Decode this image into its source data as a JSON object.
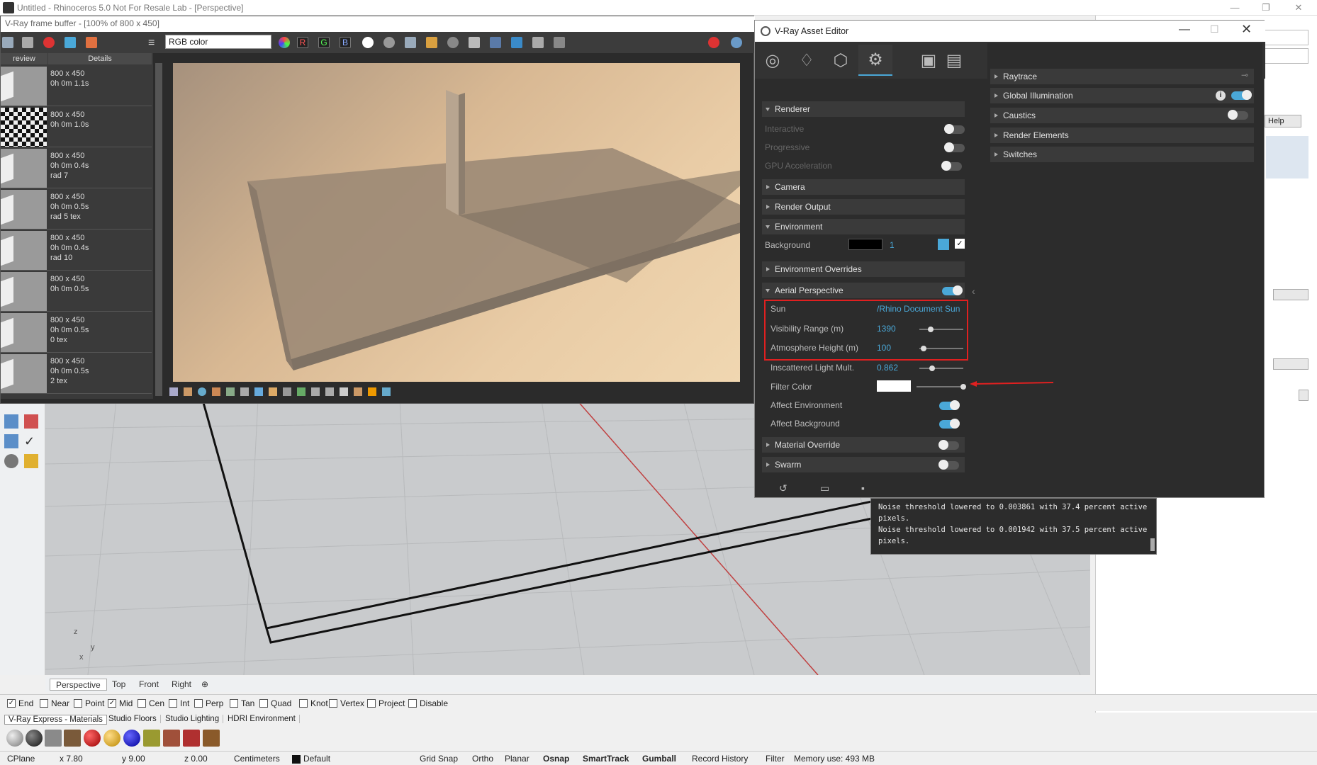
{
  "main_window": {
    "title": "Untitled - Rhinoceros 5.0 Not For Resale Lab - [Perspective]",
    "controls": [
      "—",
      "❐",
      "✕"
    ]
  },
  "frame_buffer": {
    "title": "V-Ray frame buffer - [100% of 800 x 450]",
    "channel": "RGB color",
    "channel_buttons": [
      "R",
      "G",
      "B"
    ],
    "history_headers": [
      "review",
      "Details"
    ],
    "history": [
      {
        "details": "800 x 450\n0h 0m 1.1s"
      },
      {
        "details": "800 x 450\n0h 0m 1.0s"
      },
      {
        "details": "800 x 450\n0h 0m 0.4s\nrad 7"
      },
      {
        "details": "800 x 450\n0h 0m 0.5s\nrad 5 tex"
      },
      {
        "details": "800 x 450\n0h 0m 0.4s\nrad 10"
      },
      {
        "details": "800 x 450\n0h 0m 0.5s"
      },
      {
        "details": "800 x 450\n0h 0m 0.5s\n0 tex"
      },
      {
        "details": "800 x 450\n0h 0m 0.5s\n2 tex"
      }
    ]
  },
  "asset_editor": {
    "title": "V-Ray Asset Editor",
    "left": {
      "renderer": "Renderer",
      "interactive": "Interactive",
      "progressive": "Progressive",
      "gpu": "GPU Acceleration",
      "camera": "Camera",
      "render_output": "Render Output",
      "environment": "Environment",
      "background": "Background",
      "background_value": "1",
      "env_overrides": "Environment Overrides",
      "aerial": "Aerial Perspective",
      "sun_label": "Sun",
      "sun_value": "/Rhino Document Sun",
      "visibility_label": "Visibility Range (m)",
      "visibility_value": "1390",
      "atmo_label": "Atmosphere Height (m)",
      "atmo_value": "100",
      "inscatter_label": "Inscattered Light Mult.",
      "inscatter_value": "0.862",
      "filter_label": "Filter Color",
      "affect_env": "Affect Environment",
      "affect_bg": "Affect Background",
      "material_override": "Material Override",
      "swarm": "Swarm"
    },
    "right": {
      "raytrace": "Raytrace",
      "gi": "Global Illumination",
      "caustics": "Caustics",
      "render_elements": "Render Elements",
      "switches": "Switches"
    }
  },
  "console": {
    "lines": [
      "Noise threshold lowered to 0.003861 with 37.4 percent active",
      "pixels.",
      "Noise threshold lowered to 0.001942 with 37.5 percent active",
      "pixels."
    ]
  },
  "right_panel": {
    "help": "Help"
  },
  "viewport_tabs": [
    "Perspective",
    "Top",
    "Front",
    "Right"
  ],
  "osnaps": [
    {
      "label": "End",
      "checked": true
    },
    {
      "label": "Near",
      "checked": false
    },
    {
      "label": "Point",
      "checked": false
    },
    {
      "label": "Mid",
      "checked": true
    },
    {
      "label": "Cen",
      "checked": false
    },
    {
      "label": "Int",
      "checked": false
    },
    {
      "label": "Perp",
      "checked": false
    },
    {
      "label": "Tan",
      "checked": false
    },
    {
      "label": "Quad",
      "checked": false
    },
    {
      "label": "Knot",
      "checked": false
    },
    {
      "label": "Vertex",
      "checked": false
    },
    {
      "label": "Project",
      "checked": false
    },
    {
      "label": "Disable",
      "checked": false
    }
  ],
  "material_tabs": [
    "V-Ray Express - Materials",
    "Studio Floors",
    "Studio Lighting",
    "HDRI Environment"
  ],
  "status": {
    "cplane": "CPlane",
    "x": "x 7.80",
    "y": "y 9.00",
    "z": "z 0.00",
    "units": "Centimeters",
    "layer": "Default",
    "grid_snap": "Grid Snap",
    "ortho": "Ortho",
    "planar": "Planar",
    "osnap": "Osnap",
    "smarttrack": "SmartTrack",
    "gumball": "Gumball",
    "record_history": "Record History",
    "filter": "Filter",
    "memory": "Memory use: 493 MB"
  },
  "colors": {
    "accent": "#4aa8d8",
    "highlight_box": "#e02020"
  }
}
